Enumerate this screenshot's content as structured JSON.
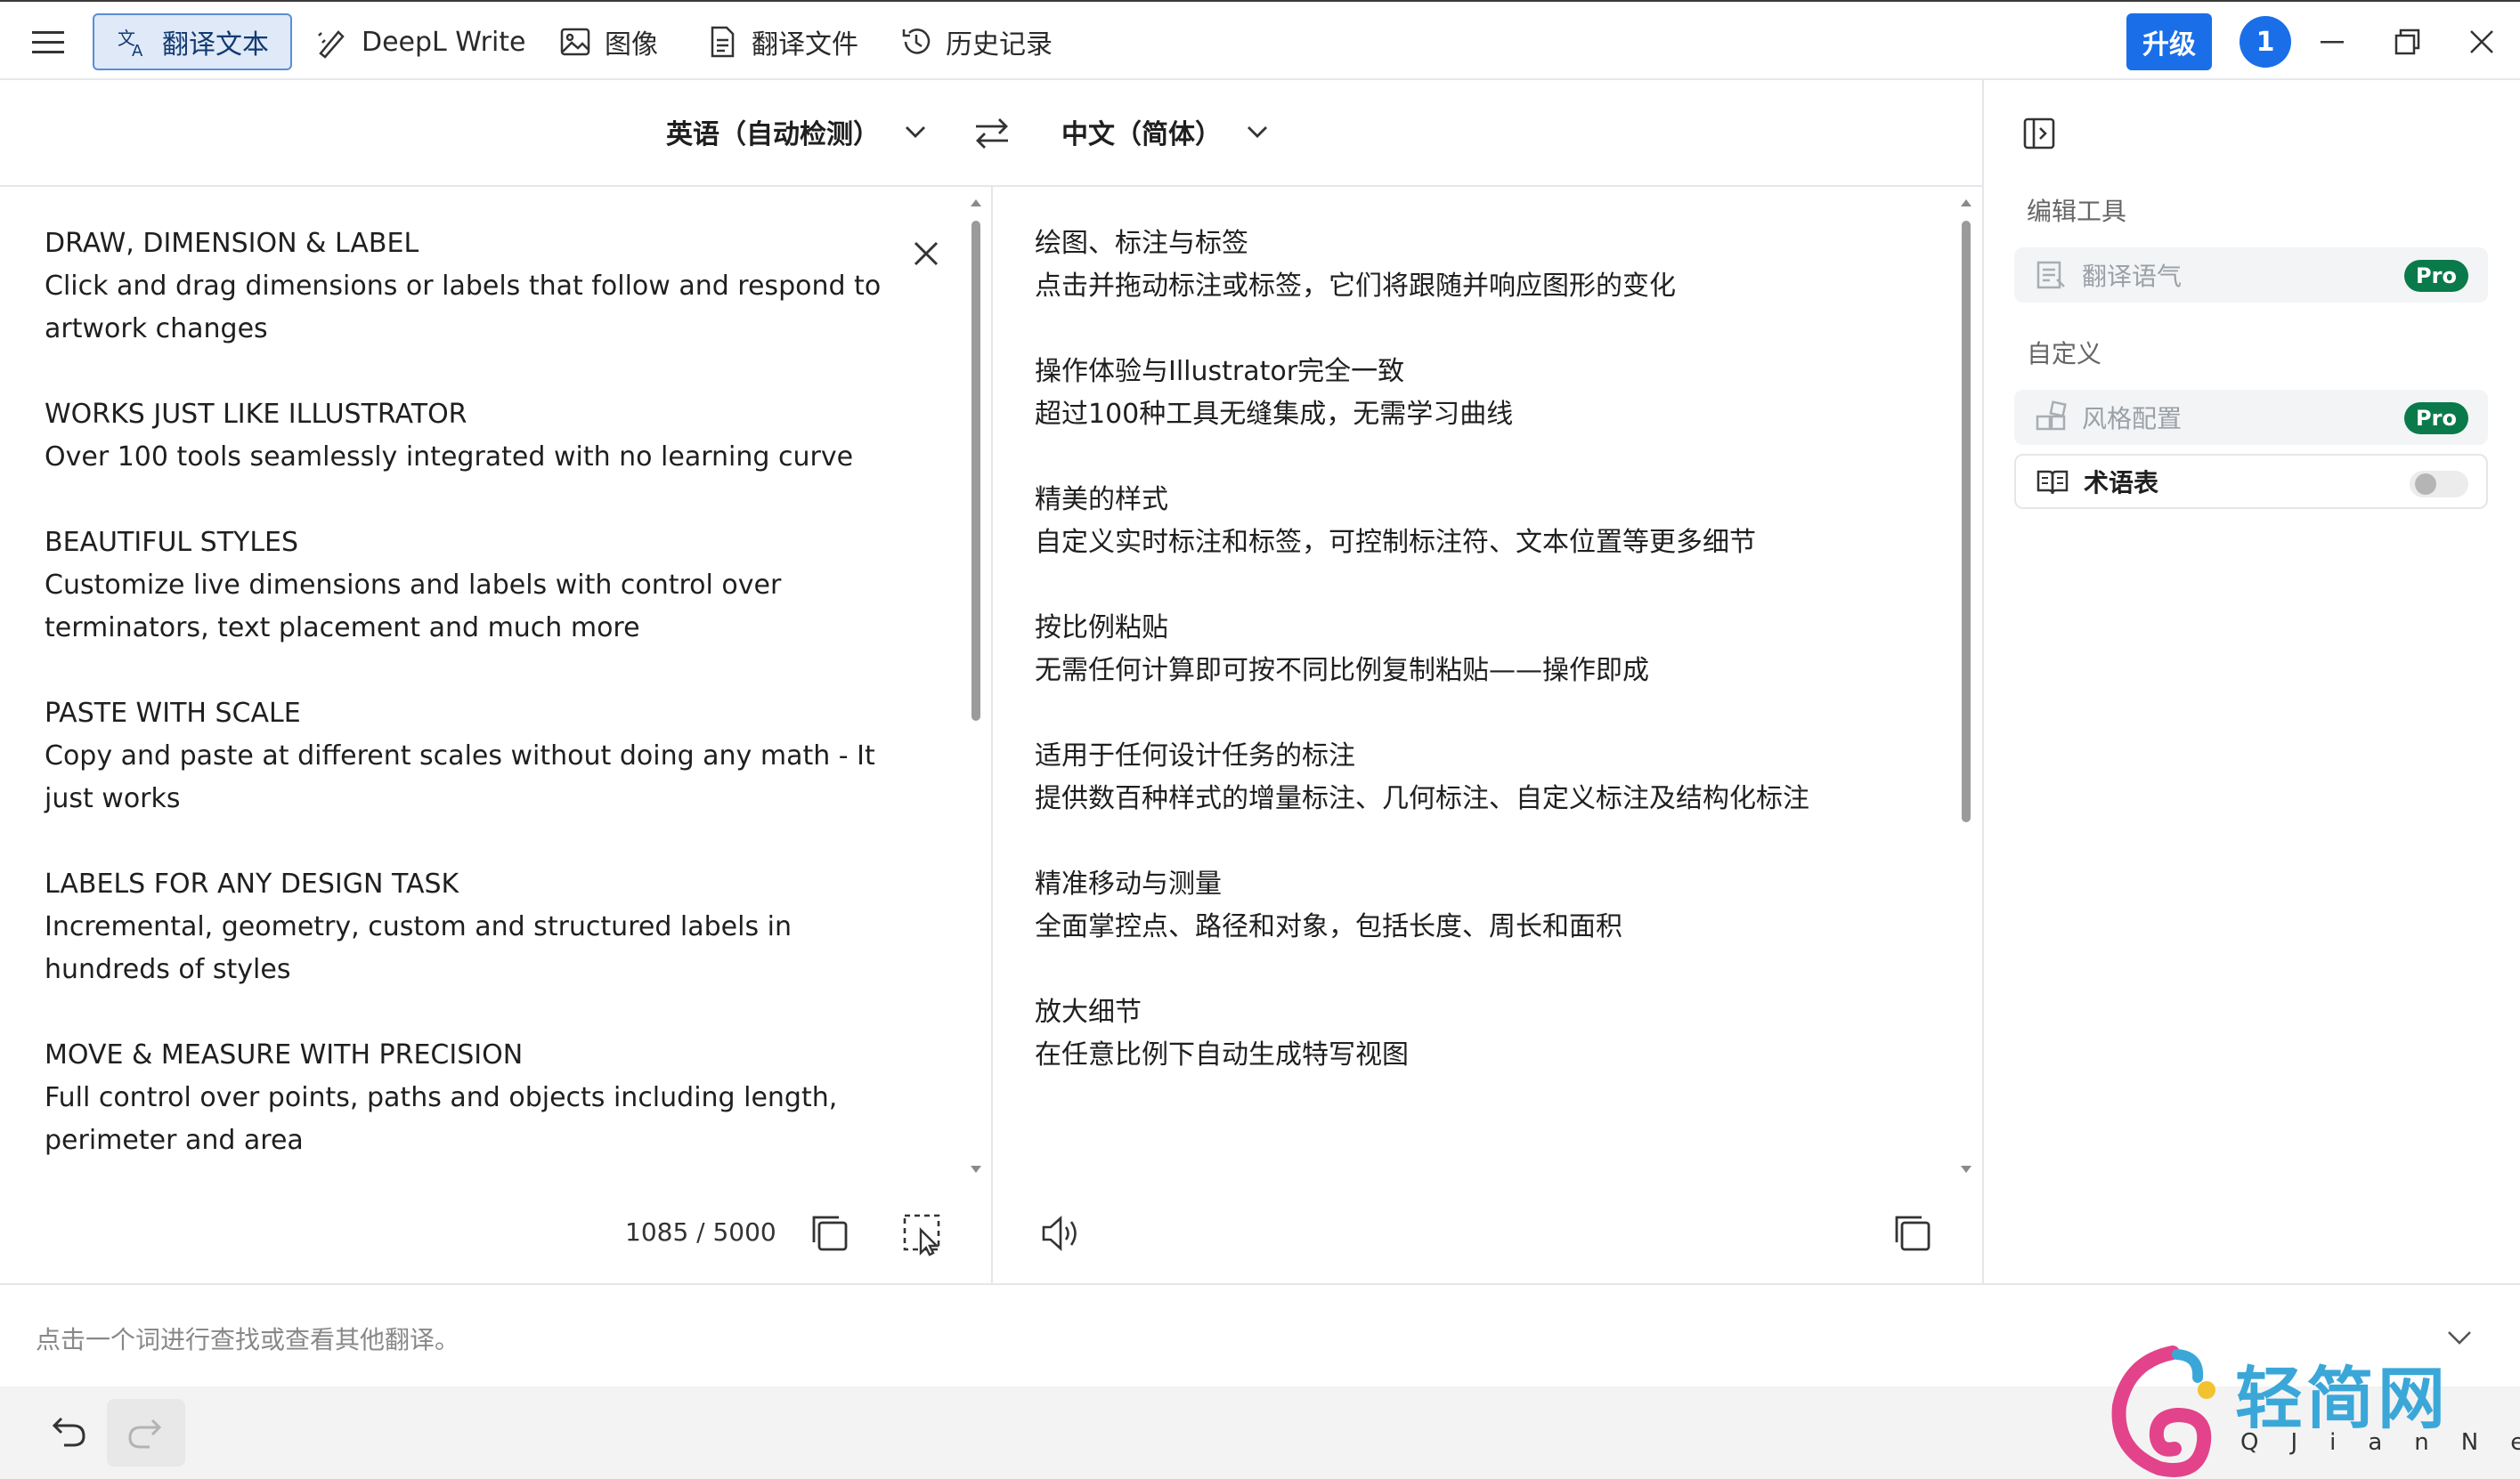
{
  "titlebar": {
    "tabs": [
      {
        "label": "翻译文本",
        "icon": "translate-icon",
        "active": true
      },
      {
        "label": "DeepL Write",
        "icon": "write-icon",
        "active": false
      },
      {
        "label": "图像",
        "icon": "image-icon",
        "active": false
      },
      {
        "label": "翻译文件",
        "icon": "document-icon",
        "active": false
      },
      {
        "label": "历史记录",
        "icon": "history-icon",
        "active": false
      }
    ],
    "upgrade_label": "升级",
    "notification_count": "1"
  },
  "languages": {
    "source": "英语（自动检测）",
    "target": "中文（简体）"
  },
  "source_text": [
    {
      "heading": "DRAW, DIMENSION & LABEL",
      "body": "Click and drag dimensions or labels that follow and respond to artwork changes"
    },
    {
      "heading": "WORKS JUST LIKE ILLUSTRATOR",
      "body": "Over 100 tools seamlessly integrated with no learning curve"
    },
    {
      "heading": "BEAUTIFUL STYLES",
      "body": "Customize live dimensions and labels with control over terminators, text placement and much more"
    },
    {
      "heading": "PASTE WITH SCALE",
      "body": "Copy and paste at different scales without doing any math - It just works"
    },
    {
      "heading": "LABELS FOR ANY DESIGN TASK",
      "body": "Incremental, geometry, custom and structured labels in hundreds of styles"
    },
    {
      "heading": "MOVE & MEASURE WITH PRECISION",
      "body": "Full control over points, paths and objects including length, perimeter and area"
    }
  ],
  "target_text": [
    {
      "heading": "绘图、标注与标签",
      "body": "点击并拖动标注或标签，它们将跟随并响应图形的变化"
    },
    {
      "heading": "操作体验与Illustrator完全一致",
      "body": "超过100种工具无缝集成，无需学习曲线"
    },
    {
      "heading": "精美的样式",
      "body": "自定义实时标注和标签，可控制标注符、文本位置等更多细节"
    },
    {
      "heading": "按比例粘贴",
      "body": "无需任何计算即可按不同比例复制粘贴——操作即成"
    },
    {
      "heading": "适用于任何设计任务的标注",
      "body": "提供数百种样式的增量标注、几何标注、自定义标注及结构化标注"
    },
    {
      "heading": "精准移动与测量",
      "body": "全面掌控点、路径和对象，包括长度、周长和面积"
    },
    {
      "heading": "放大细节",
      "body": "在任意比例下自动生成特写视图"
    }
  ],
  "source_footer": {
    "char_count": "1085 / 5000"
  },
  "sidebar": {
    "edit_tools_title": "编辑工具",
    "tone_label": "翻译语气",
    "custom_title": "自定义",
    "style_label": "风格配置",
    "glossary_label": "术语表",
    "pro_badge": "Pro"
  },
  "lookup": {
    "placeholder": "点击一个词进行查找或查看其他翻译。"
  },
  "watermark": {
    "name": "轻简网",
    "sub": "QJianNet"
  },
  "colors": {
    "accent": "#1a6fe8",
    "pro_badge": "#0a7a4a",
    "active_tab_bg": "#dfe9f8"
  }
}
